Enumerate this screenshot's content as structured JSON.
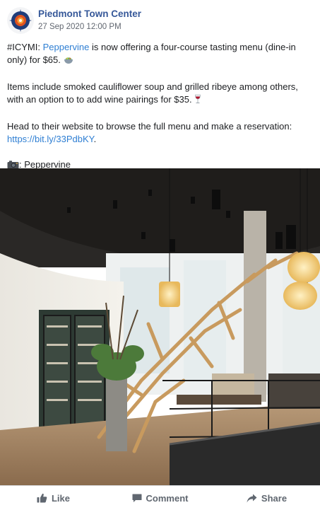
{
  "page": {
    "name": "Piedmont Town Center",
    "timestamp": "27 Sep 2020 12:00 PM"
  },
  "post": {
    "p1_prefix": "#ICYMI: ",
    "p1_link": "Peppervine",
    "p1_suffix": " is now offering a four-course tasting menu (dine-in only) for $65.",
    "p2": "Items include smoked cauliflower soup and grilled ribeye among others, with an option to to add wine pairings for $35.",
    "p3": "Head to their website to browse the full menu and make a reservation:",
    "p3_link": "https://bit.ly/33PdbKY",
    "p3_suffix": ".",
    "p4": ": Peppervine"
  },
  "actions": {
    "like": "Like",
    "comment": "Comment",
    "share": "Share"
  },
  "colors": {
    "page_name": "#365899",
    "link": "#2f7fd3",
    "muted": "#616770"
  },
  "icons": [
    "logo-icon",
    "bowl-emoji-icon",
    "wine-glass-emoji-icon",
    "camera-emoji-icon",
    "like-icon",
    "comment-icon",
    "share-icon"
  ]
}
